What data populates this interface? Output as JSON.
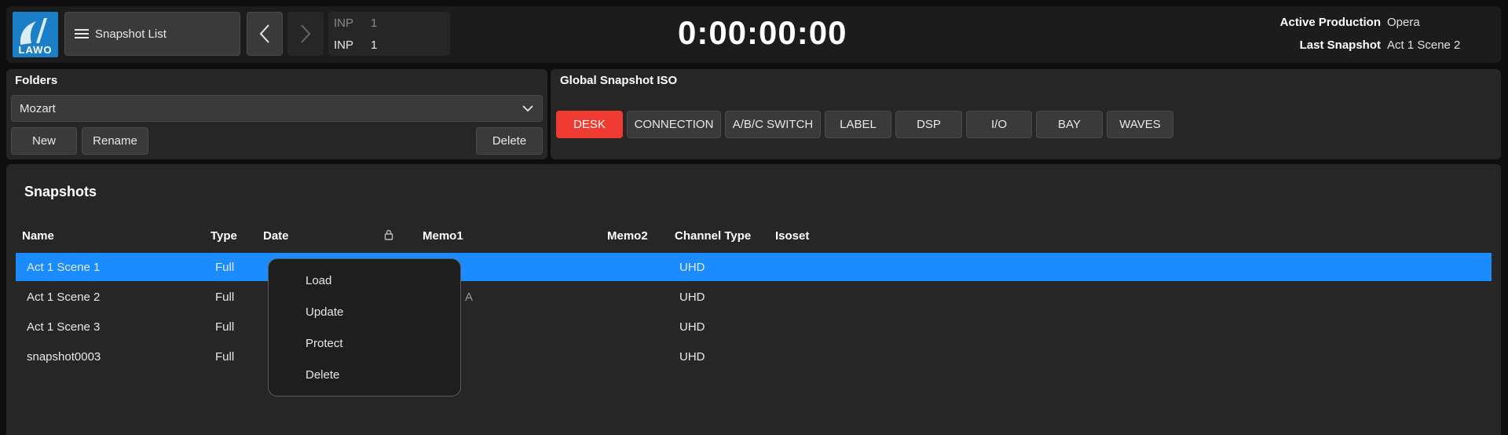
{
  "logo": {
    "text": "LAWO"
  },
  "topbar": {
    "snapshot_list_label": "Snapshot List",
    "inp_rows": [
      {
        "label": "INP",
        "value": "1"
      },
      {
        "label": "INP",
        "value": "1"
      }
    ],
    "timecode": "0:00:00:00",
    "active_production_label": "Active Production",
    "active_production_value": "Opera",
    "last_snapshot_label": "Last Snapshot",
    "last_snapshot_value": "Act 1 Scene 2"
  },
  "folders": {
    "title": "Folders",
    "selected": "Mozart",
    "new_label": "New",
    "rename_label": "Rename",
    "delete_label": "Delete"
  },
  "iso": {
    "title": "Global Snapshot ISO",
    "buttons": [
      "DESK",
      "CONNECTION",
      "A/B/C SWITCH",
      "LABEL",
      "DSP",
      "I/O",
      "BAY",
      "WAVES"
    ],
    "active": "DESK"
  },
  "snapshots": {
    "title": "Snapshots",
    "columns": [
      "Name",
      "Type",
      "Date",
      "Memo1",
      "Memo2",
      "Channel Type",
      "Isoset"
    ],
    "rows": [
      {
        "name": "Act 1 Scene 1",
        "type": "Full",
        "memo1": "",
        "channel_type": "UHD"
      },
      {
        "name": "Act 1 Scene 2",
        "type": "Full",
        "memo1": "A",
        "channel_type": "UHD"
      },
      {
        "name": "Act 1 Scene 3",
        "type": "Full",
        "memo1": "",
        "channel_type": "UHD"
      },
      {
        "name": "snapshot0003",
        "type": "Full",
        "memo1": "",
        "channel_type": "UHD"
      }
    ]
  },
  "context_menu": {
    "items": [
      "Load",
      "Update",
      "Protect",
      "Delete"
    ]
  },
  "colors": {
    "accent": "#1a8cff",
    "active_button": "#f03b33",
    "logo": "#1a7fc6"
  }
}
